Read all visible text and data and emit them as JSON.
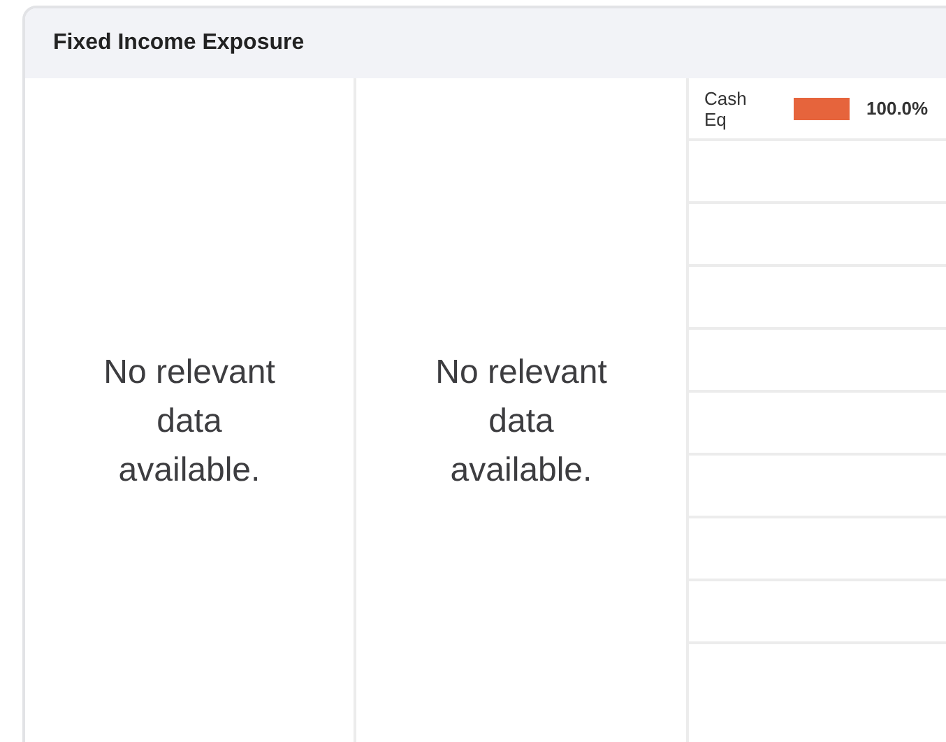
{
  "card": {
    "title": "Fixed Income Exposure"
  },
  "panels": [
    {
      "kind": "empty",
      "message": "No relevant data available."
    },
    {
      "kind": "empty",
      "message": "No relevant data available."
    },
    {
      "kind": "bars",
      "rows": [
        {
          "label": "Cash Eq",
          "level": 1,
          "value": "100.0%",
          "color": "#e6643c"
        }
      ]
    }
  ]
}
